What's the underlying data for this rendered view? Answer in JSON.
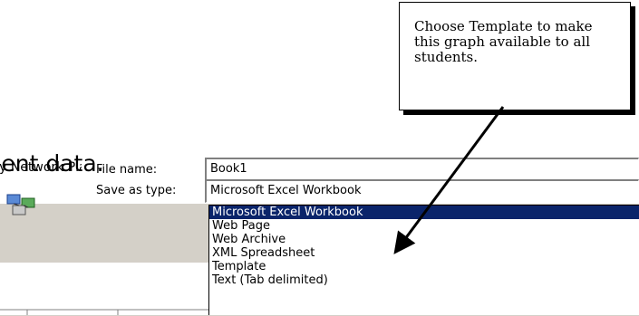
{
  "heading": {
    "text": "Student data."
  },
  "dialog": {
    "places": {
      "label": "My Network Places"
    },
    "file_name": {
      "label": "File name:",
      "value": "Book1"
    },
    "save_as_type": {
      "label": "Save as type:",
      "value": "Microsoft Excel Workbook",
      "options": [
        "Microsoft Excel Workbook",
        "Web Page",
        "Web Archive",
        "XML Spreadsheet",
        "Template",
        "Text (Tab delimited)"
      ],
      "selected_index": 0
    }
  },
  "callout": {
    "text": "Choose Template to make this graph available to all students."
  },
  "colors": {
    "dialog_bg": "#d4d0c8",
    "selection_bg": "#0a246a",
    "selection_text": "#ffffff"
  },
  "icons": {
    "places": "network-places-icon"
  }
}
